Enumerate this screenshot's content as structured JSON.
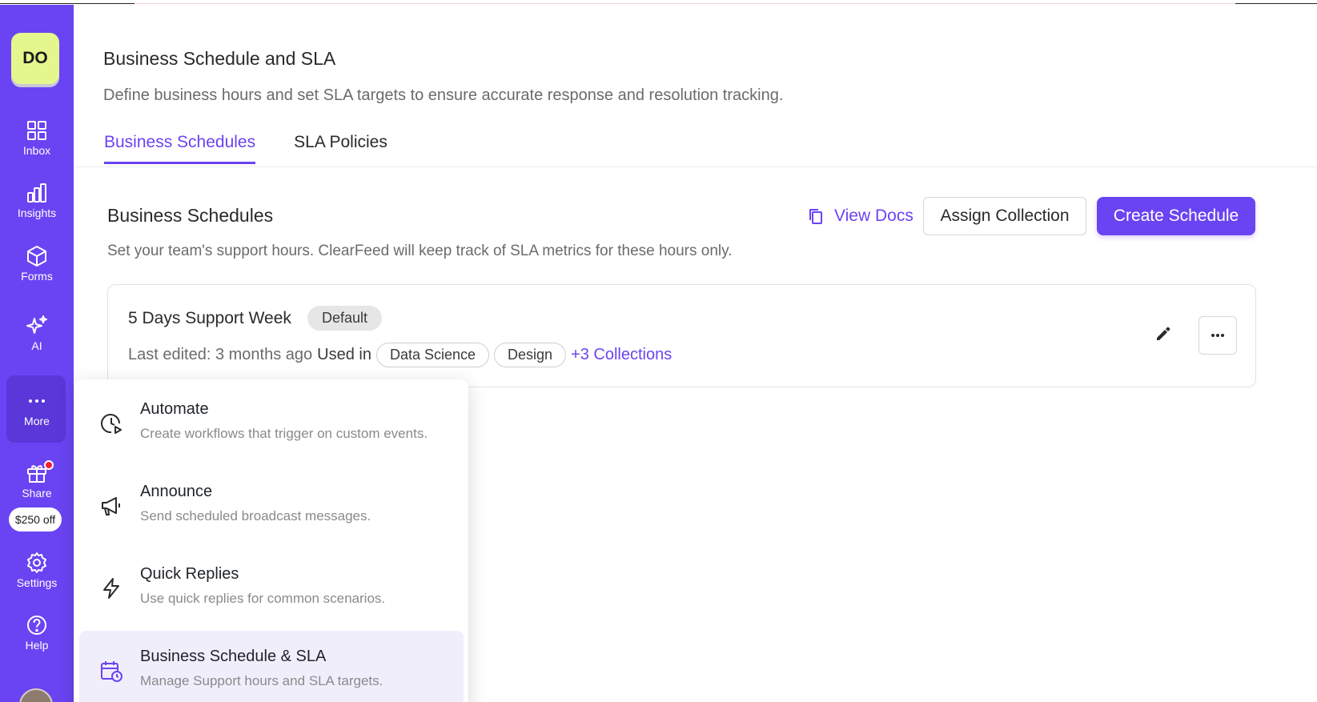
{
  "sidebar": {
    "avatar_initials": "DO",
    "items": [
      {
        "label": "Inbox",
        "icon": "grid-icon"
      },
      {
        "label": "Insights",
        "icon": "bar-chart-icon"
      },
      {
        "label": "Forms",
        "icon": "cube-icon"
      },
      {
        "label": "AI",
        "icon": "sparkles-icon"
      },
      {
        "label": "More",
        "icon": "dots-horizontal-icon"
      },
      {
        "label": "Share",
        "icon": "gift-icon"
      },
      {
        "label": "Settings",
        "icon": "gear-icon"
      },
      {
        "label": "Help",
        "icon": "help-circle-icon"
      }
    ],
    "promo": "$250 off",
    "accent_color": "#6a44f2"
  },
  "header": {
    "title": "Business Schedule and SLA",
    "subtitle": "Define business hours and set SLA targets to ensure accurate response and resolution tracking.",
    "tabs": [
      {
        "label": "Business Schedules",
        "active": true
      },
      {
        "label": "SLA Policies",
        "active": false
      }
    ]
  },
  "section": {
    "title": "Business Schedules",
    "subtitle": "Set your team's support hours. ClearFeed will keep track of SLA metrics for these hours only.",
    "view_docs": "View Docs",
    "assign_collection": "Assign Collection",
    "create_schedule": "Create Schedule"
  },
  "schedule_card": {
    "name": "5 Days Support Week",
    "badge": "Default",
    "last_edited": "Last edited: 3 months ago",
    "used_in": "Used in",
    "collections": [
      "Data Science",
      "Design"
    ],
    "more_collections": "+3 Collections"
  },
  "more_menu": {
    "items": [
      {
        "title": "Automate",
        "description": "Create workflows that trigger on custom events.",
        "icon": "clock-play-icon",
        "active": false
      },
      {
        "title": "Announce",
        "description": "Send scheduled broadcast messages.",
        "icon": "megaphone-icon",
        "active": false
      },
      {
        "title": "Quick Replies",
        "description": "Use quick replies for common scenarios.",
        "icon": "lightning-icon",
        "active": false
      },
      {
        "title": "Business Schedule & SLA",
        "description": "Manage Support hours and SLA targets.",
        "icon": "calendar-clock-icon",
        "active": true
      }
    ]
  }
}
